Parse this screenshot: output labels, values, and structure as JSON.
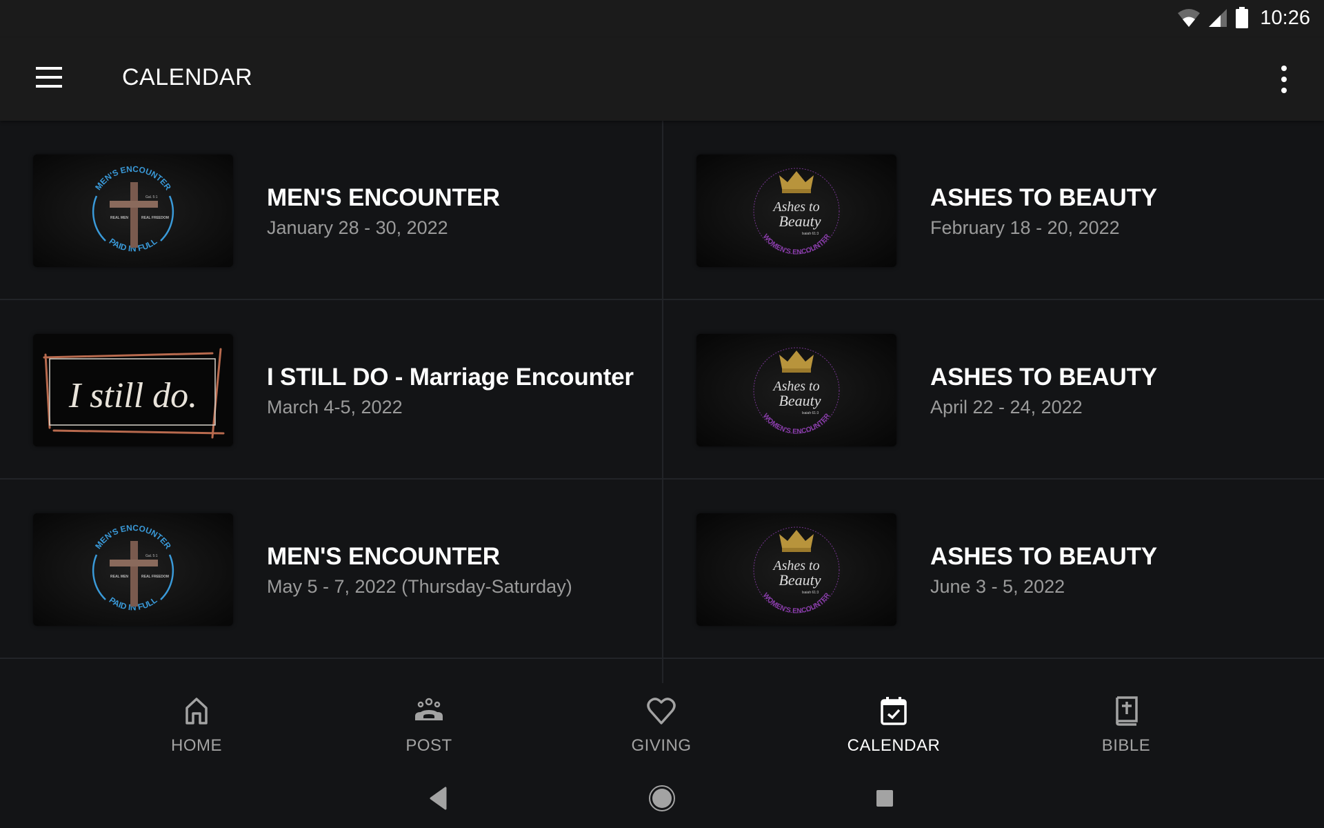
{
  "status_bar": {
    "time": "10:26",
    "icons": [
      "wifi-icon",
      "cell-signal-icon",
      "battery-icon"
    ]
  },
  "app_bar": {
    "menu_icon": "hamburger-menu-icon",
    "title": "CALENDAR",
    "overflow_icon": "more-vert-icon"
  },
  "events": [
    {
      "title": "MEN'S ENCOUNTER",
      "date": "January 28 - 30, 2022",
      "image": "mens-encounter-logo",
      "image_text": {
        "top": "MEN'S ENCOUNTER",
        "bottom": "PAID IN FULL",
        "left": "REAL MEN",
        "right": "REAL FREEDOM",
        "verse": "Gal. 5:1"
      }
    },
    {
      "title": "ASHES TO BEAUTY",
      "date": "February 18 - 20, 2022",
      "image": "ashes-to-beauty-logo",
      "image_text": {
        "script1": "Ashes to",
        "script2": "Beauty",
        "verse": "Isaiah 61:3",
        "bottom": "WOMEN'S ENCOUNTER"
      }
    },
    {
      "title": "I STILL DO - Marriage Encounter",
      "date": "March 4-5, 2022",
      "image": "i-still-do-logo",
      "image_text": {
        "script": "I still do."
      }
    },
    {
      "title": "ASHES TO BEAUTY",
      "date": "April 22 - 24, 2022",
      "image": "ashes-to-beauty-logo",
      "image_text": {
        "script1": "Ashes to",
        "script2": "Beauty",
        "verse": "Isaiah 61:3",
        "bottom": "WOMEN'S ENCOUNTER"
      }
    },
    {
      "title": "MEN'S ENCOUNTER",
      "date": "May 5 - 7, 2022 (Thursday-Saturday)",
      "image": "mens-encounter-logo",
      "image_text": {
        "top": "MEN'S ENCOUNTER",
        "bottom": "PAID IN FULL",
        "left": "REAL MEN",
        "right": "REAL FREEDOM",
        "verse": "Gal. 5:1"
      }
    },
    {
      "title": "ASHES TO BEAUTY",
      "date": "June 3 - 5, 2022",
      "image": "ashes-to-beauty-logo",
      "image_text": {
        "script1": "Ashes to",
        "script2": "Beauty",
        "verse": "Isaiah 61:3",
        "bottom": "WOMEN'S ENCOUNTER"
      }
    }
  ],
  "bottom_nav": {
    "active": "CALENDAR",
    "items": [
      {
        "label": "HOME",
        "icon": "home-icon"
      },
      {
        "label": "POST",
        "icon": "group-icon"
      },
      {
        "label": "GIVING",
        "icon": "heart-icon"
      },
      {
        "label": "CALENDAR",
        "icon": "calendar-check-icon"
      },
      {
        "label": "BIBLE",
        "icon": "bible-icon"
      }
    ]
  },
  "system_nav": [
    "back-icon",
    "home-circle-icon",
    "recents-icon"
  ],
  "colors": {
    "background": "#131416",
    "app_bar": "#1b1b1b",
    "text_primary": "#ffffff",
    "text_secondary": "#9b9b9b",
    "nav_inactive": "#a3a3a3",
    "mens_accent": "#3a9ad9",
    "ashes_accent": "#8e3fb0",
    "crown_gold": "#b8943c",
    "still_do_accent": "#b86a4e"
  }
}
